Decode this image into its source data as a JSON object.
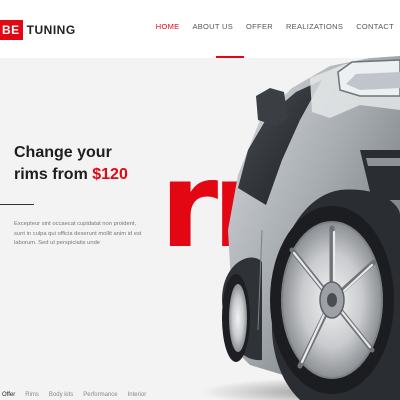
{
  "logo": {
    "mark": "BE",
    "name": "TUNING"
  },
  "nav": {
    "items": [
      "HOME",
      "ABOUT US",
      "OFFER",
      "REALIZATIONS",
      "CONTACT"
    ],
    "active_index": 0
  },
  "hero": {
    "bg_letters": "rr",
    "headline_line1": "Change your",
    "headline_line2_prefix": "rims from ",
    "headline_price": "$120",
    "paragraph": "Excepteur sint occaecat cupidatat non proident, sunt in culpa qui officia deserunt mollit anim id est laborum. Sed ut perspiciatis unde"
  },
  "tabs": {
    "items": [
      "Offer",
      "Rims",
      "Body kits",
      "Performance",
      "Interior"
    ],
    "active_index": 0
  },
  "colors": {
    "accent": "#e30613",
    "text_dark": "#1e1e1e",
    "background": "#f3f3f3"
  },
  "icons": {
    "car": "car-illustration"
  }
}
